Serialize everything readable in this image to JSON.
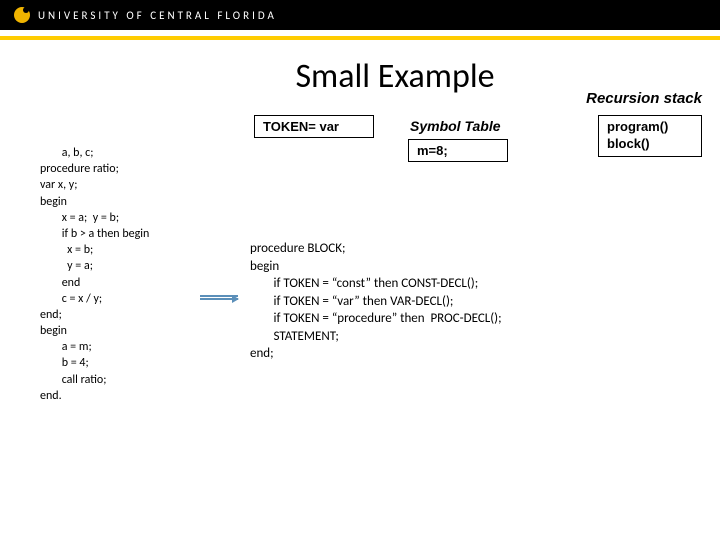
{
  "header": {
    "university": "UNIVERSITY OF CENTRAL FLORIDA"
  },
  "title": "Small Example",
  "recursion_label": "Recursion stack",
  "token_box": "TOKEN= var",
  "symbol_table_label": "Symbol Table",
  "m8": "m=8;",
  "stack": {
    "line1": "program()",
    "line2": "block()"
  },
  "left_code": "        a, b, c;\nprocedure ratio;\nvar x, y;\nbegin\n        x = a;  y = b;\n        if b > a then begin\n          x = b;\n          y = a;\n        end\n        c = x / y;\nend;\nbegin\n        a = m;\n        b = 4;\n        call ratio;\nend.",
  "right_code": "procedure BLOCK;\nbegin\n        if TOKEN = “const” then CONST-DECL();\n        if TOKEN = “var” then VAR-DECL();\n        if TOKEN = “procedure” then  PROC-DECL();\n        STATEMENT;\nend;"
}
